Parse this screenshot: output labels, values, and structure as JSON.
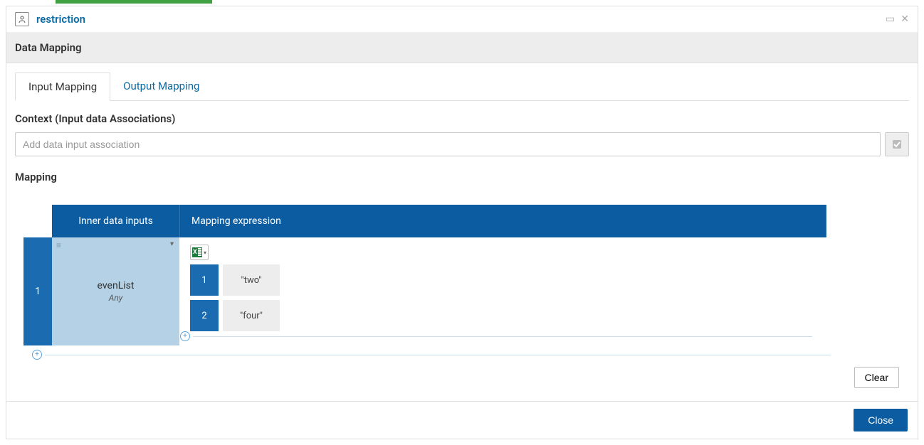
{
  "dialog": {
    "title": "restriction",
    "section_title": "Data Mapping"
  },
  "tabs": {
    "input": "Input Mapping",
    "output": "Output Mapping"
  },
  "context": {
    "heading": "Context (Input data Associations)",
    "placeholder": "Add data input association"
  },
  "mapping": {
    "heading": "Mapping",
    "headers": {
      "inner": "Inner data inputs",
      "expr": "Mapping expression"
    },
    "row_number": "1",
    "input": {
      "name": "evenList",
      "type": "Any"
    },
    "items": [
      {
        "index": "1",
        "value": "\"two\""
      },
      {
        "index": "2",
        "value": "\"four\""
      }
    ]
  },
  "buttons": {
    "clear": "Clear",
    "close": "Close"
  }
}
